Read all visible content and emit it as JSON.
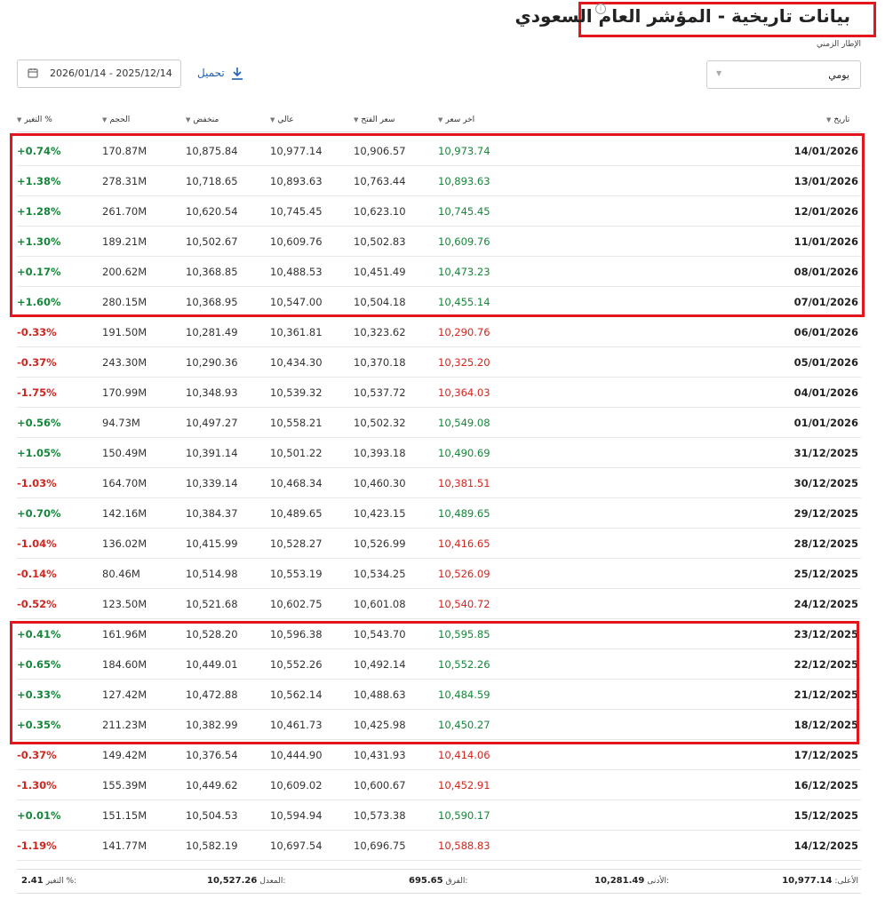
{
  "header": {
    "title": "بيانات تاريخية - المؤشر العام السعودي",
    "info_icon": "i",
    "timeframe_label": "الإطار الزمني",
    "timeframe_value": "يومي",
    "date_range": "2026/01/14 - 2025/12/14",
    "download_label": "تحميل"
  },
  "columns": {
    "date": "تاريخ",
    "last": "اخر سعر",
    "open": "سعر الفتح",
    "high": "عالي",
    "low": "منخفض",
    "volume": "الحجم",
    "change": "التغير %"
  },
  "rows": [
    {
      "date": "14/01/2026",
      "last": "10,973.74",
      "open": "10,906.57",
      "high": "10,977.14",
      "low": "10,875.84",
      "volume": "170.87M",
      "change": "+0.74%",
      "dir": "up"
    },
    {
      "date": "13/01/2026",
      "last": "10,893.63",
      "open": "10,763.44",
      "high": "10,893.63",
      "low": "10,718.65",
      "volume": "278.31M",
      "change": "+1.38%",
      "dir": "up"
    },
    {
      "date": "12/01/2026",
      "last": "10,745.45",
      "open": "10,623.10",
      "high": "10,745.45",
      "low": "10,620.54",
      "volume": "261.70M",
      "change": "+1.28%",
      "dir": "up"
    },
    {
      "date": "11/01/2026",
      "last": "10,609.76",
      "open": "10,502.83",
      "high": "10,609.76",
      "low": "10,502.67",
      "volume": "189.21M",
      "change": "+1.30%",
      "dir": "up"
    },
    {
      "date": "08/01/2026",
      "last": "10,473.23",
      "open": "10,451.49",
      "high": "10,488.53",
      "low": "10,368.85",
      "volume": "200.62M",
      "change": "+0.17%",
      "dir": "up"
    },
    {
      "date": "07/01/2026",
      "last": "10,455.14",
      "open": "10,504.18",
      "high": "10,547.00",
      "low": "10,368.95",
      "volume": "280.15M",
      "change": "+1.60%",
      "dir": "up"
    },
    {
      "date": "06/01/2026",
      "last": "10,290.76",
      "open": "10,323.62",
      "high": "10,361.81",
      "low": "10,281.49",
      "volume": "191.50M",
      "change": "-0.33%",
      "dir": "down"
    },
    {
      "date": "05/01/2026",
      "last": "10,325.20",
      "open": "10,370.18",
      "high": "10,434.30",
      "low": "10,290.36",
      "volume": "243.30M",
      "change": "-0.37%",
      "dir": "down"
    },
    {
      "date": "04/01/2026",
      "last": "10,364.03",
      "open": "10,537.72",
      "high": "10,539.32",
      "low": "10,348.93",
      "volume": "170.99M",
      "change": "-1.75%",
      "dir": "down"
    },
    {
      "date": "01/01/2026",
      "last": "10,549.08",
      "open": "10,502.32",
      "high": "10,558.21",
      "low": "10,497.27",
      "volume": "94.73M",
      "change": "+0.56%",
      "dir": "up"
    },
    {
      "date": "31/12/2025",
      "last": "10,490.69",
      "open": "10,393.18",
      "high": "10,501.22",
      "low": "10,391.14",
      "volume": "150.49M",
      "change": "+1.05%",
      "dir": "up"
    },
    {
      "date": "30/12/2025",
      "last": "10,381.51",
      "open": "10,460.30",
      "high": "10,468.34",
      "low": "10,339.14",
      "volume": "164.70M",
      "change": "-1.03%",
      "dir": "down"
    },
    {
      "date": "29/12/2025",
      "last": "10,489.65",
      "open": "10,423.15",
      "high": "10,489.65",
      "low": "10,384.37",
      "volume": "142.16M",
      "change": "+0.70%",
      "dir": "up"
    },
    {
      "date": "28/12/2025",
      "last": "10,416.65",
      "open": "10,526.99",
      "high": "10,528.27",
      "low": "10,415.99",
      "volume": "136.02M",
      "change": "-1.04%",
      "dir": "down"
    },
    {
      "date": "25/12/2025",
      "last": "10,526.09",
      "open": "10,534.25",
      "high": "10,553.19",
      "low": "10,514.98",
      "volume": "80.46M",
      "change": "-0.14%",
      "dir": "down"
    },
    {
      "date": "24/12/2025",
      "last": "10,540.72",
      "open": "10,601.08",
      "high": "10,602.75",
      "low": "10,521.68",
      "volume": "123.50M",
      "change": "-0.52%",
      "dir": "down"
    },
    {
      "date": "23/12/2025",
      "last": "10,595.85",
      "open": "10,543.70",
      "high": "10,596.38",
      "low": "10,528.20",
      "volume": "161.96M",
      "change": "+0.41%",
      "dir": "up"
    },
    {
      "date": "22/12/2025",
      "last": "10,552.26",
      "open": "10,492.14",
      "high": "10,552.26",
      "low": "10,449.01",
      "volume": "184.60M",
      "change": "+0.65%",
      "dir": "up"
    },
    {
      "date": "21/12/2025",
      "last": "10,484.59",
      "open": "10,488.63",
      "high": "10,562.14",
      "low": "10,472.88",
      "volume": "127.42M",
      "change": "+0.33%",
      "dir": "up"
    },
    {
      "date": "18/12/2025",
      "last": "10,450.27",
      "open": "10,425.98",
      "high": "10,461.73",
      "low": "10,382.99",
      "volume": "211.23M",
      "change": "+0.35%",
      "dir": "up"
    },
    {
      "date": "17/12/2025",
      "last": "10,414.06",
      "open": "10,431.93",
      "high": "10,444.90",
      "low": "10,376.54",
      "volume": "149.42M",
      "change": "-0.37%",
      "dir": "down"
    },
    {
      "date": "16/12/2025",
      "last": "10,452.91",
      "open": "10,600.67",
      "high": "10,609.02",
      "low": "10,449.62",
      "volume": "155.39M",
      "change": "-1.30%",
      "dir": "down"
    },
    {
      "date": "15/12/2025",
      "last": "10,590.17",
      "open": "10,573.38",
      "high": "10,594.94",
      "low": "10,504.53",
      "volume": "151.15M",
      "change": "+0.01%",
      "dir": "up"
    },
    {
      "date": "14/12/2025",
      "last": "10,588.83",
      "open": "10,696.75",
      "high": "10,697.54",
      "low": "10,582.19",
      "volume": "141.77M",
      "change": "-1.19%",
      "dir": "down"
    }
  ],
  "summary": {
    "high_label": "الأعلى:",
    "high_value": "10,977.14",
    "low_label": "الأدنى:",
    "low_value": "10,281.49",
    "diff_label": "الفرق:",
    "diff_value": "695.65",
    "avg_label": "المعدل:",
    "avg_value": "10,527.26",
    "change_label": "التغير %:",
    "change_value": "2.41"
  },
  "colors": {
    "up": "#16873a",
    "down": "#d2261f",
    "highlight": "#e3161e",
    "link": "#1f5fb5"
  }
}
